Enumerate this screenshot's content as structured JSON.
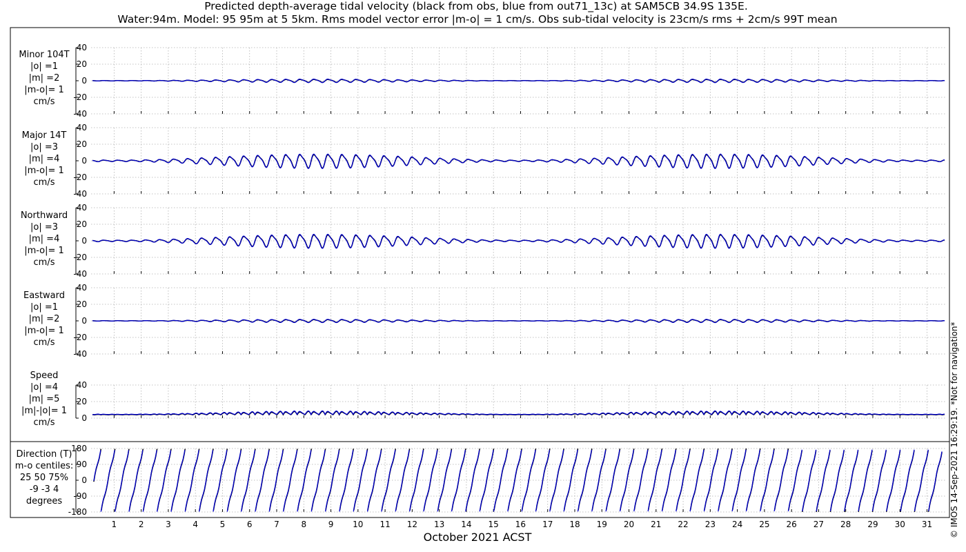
{
  "figure": {
    "title_line1": "Predicted depth-average tidal velocity (black from obs, blue from out71_13c) at SAM5CB 34.9S 135E.",
    "title_line2": "Water:94m. Model: 95 95m at 5 5km. Rms model vector error |m-o| = 1 cm/s. Obs sub-tidal velocity is 23cm/s rms + 2cm/s 99T mean",
    "xlabel": "October 2021 ACST",
    "copyright": "© IMOS 14-Sep-2021 16:29:19. *Not for navigation*",
    "colors": {
      "obs": "#000000",
      "model": "#0000cc",
      "grid": "#b0b0b0"
    }
  },
  "chart_data": [
    {
      "type": "line",
      "name": "minor",
      "label_lines": [
        "Minor 104T",
        "|o| =1",
        "|m| =2",
        "|m-o|= 1",
        "cm/s"
      ],
      "ylim": [
        -40,
        40
      ],
      "yticks": [
        40,
        20,
        0,
        -20,
        -40
      ],
      "xlim": [
        0.15,
        31.7
      ],
      "xticks": [
        1,
        2,
        3,
        4,
        5,
        6,
        7,
        8,
        9,
        10,
        11,
        12,
        13,
        14,
        15,
        16,
        17,
        18,
        19,
        20,
        21,
        22,
        23,
        24,
        25,
        26,
        27,
        28,
        29,
        30,
        31
      ],
      "series": [
        {
          "role": "obs",
          "amplitude": 1.6,
          "offset": 0
        },
        {
          "role": "model",
          "amplitude": 1.9,
          "offset": 0
        }
      ]
    },
    {
      "type": "line",
      "name": "major",
      "label_lines": [
        "Major 14T",
        "|o| =3",
        "|m| =4",
        "|m-o|= 1",
        "cm/s"
      ],
      "ylim": [
        -40,
        40
      ],
      "yticks": [
        40,
        20,
        0,
        -20,
        -40
      ],
      "xlim": [
        0.15,
        31.7
      ],
      "xticks": [
        1,
        2,
        3,
        4,
        5,
        6,
        7,
        8,
        9,
        10,
        11,
        12,
        13,
        14,
        15,
        16,
        17,
        18,
        19,
        20,
        21,
        22,
        23,
        24,
        25,
        26,
        27,
        28,
        29,
        30,
        31
      ],
      "series": [
        {
          "role": "obs",
          "amplitude": 7.5,
          "offset": 0
        },
        {
          "role": "model",
          "amplitude": 8.0,
          "offset": 0
        }
      ]
    },
    {
      "type": "line",
      "name": "northward",
      "label_lines": [
        "Northward",
        "|o| =3",
        "|m| =4",
        "|m-o|= 1",
        "cm/s"
      ],
      "ylim": [
        -40,
        40
      ],
      "yticks": [
        40,
        20,
        0,
        -20,
        -40
      ],
      "xlim": [
        0.15,
        31.7
      ],
      "xticks": [
        1,
        2,
        3,
        4,
        5,
        6,
        7,
        8,
        9,
        10,
        11,
        12,
        13,
        14,
        15,
        16,
        17,
        18,
        19,
        20,
        21,
        22,
        23,
        24,
        25,
        26,
        27,
        28,
        29,
        30,
        31
      ],
      "series": [
        {
          "role": "obs",
          "amplitude": 7.3,
          "offset": 0
        },
        {
          "role": "model",
          "amplitude": 7.8,
          "offset": 0
        }
      ]
    },
    {
      "type": "line",
      "name": "eastward",
      "label_lines": [
        "Eastward",
        "|o| =1",
        "|m| =2",
        "|m-o|= 1",
        "cm/s"
      ],
      "ylim": [
        -40,
        40
      ],
      "yticks": [
        40,
        20,
        0,
        -20,
        -40
      ],
      "xlim": [
        0.15,
        31.7
      ],
      "xticks": [
        1,
        2,
        3,
        4,
        5,
        6,
        7,
        8,
        9,
        10,
        11,
        12,
        13,
        14,
        15,
        16,
        17,
        18,
        19,
        20,
        21,
        22,
        23,
        24,
        25,
        26,
        27,
        28,
        29,
        30,
        31
      ],
      "series": [
        {
          "role": "obs",
          "amplitude": 1.5,
          "offset": 0
        },
        {
          "role": "model",
          "amplitude": 1.8,
          "offset": 0
        }
      ]
    },
    {
      "type": "line",
      "name": "speed",
      "label_lines": [
        "Speed",
        "|o| =4",
        "|m| =5",
        "|m|-|o|= 1",
        "cm/s"
      ],
      "ylim": [
        0,
        40
      ],
      "yticks": [
        40,
        20,
        0
      ],
      "xlim": [
        0.15,
        31.7
      ],
      "xticks": [
        1,
        2,
        3,
        4,
        5,
        6,
        7,
        8,
        9,
        10,
        11,
        12,
        13,
        14,
        15,
        16,
        17,
        18,
        19,
        20,
        21,
        22,
        23,
        24,
        25,
        26,
        27,
        28,
        29,
        30,
        31
      ],
      "series": [
        {
          "role": "obs",
          "amplitude": 3.5,
          "offset": 4
        },
        {
          "role": "model",
          "amplitude": 3.8,
          "offset": 4.3
        }
      ]
    },
    {
      "type": "line",
      "name": "direction",
      "label_lines": [
        "Direction (T)",
        "m-o centiles:",
        "25  50  75%",
        "-9 -3  4",
        "degrees"
      ],
      "ylim": [
        -180,
        180
      ],
      "yticks": [
        180,
        90,
        0,
        -90,
        -180
      ],
      "ytick_labels": [
        "180",
        "90",
        "0",
        "-90",
        "-180"
      ],
      "xlim": [
        0.15,
        31.7
      ],
      "xticks": [
        1,
        2,
        3,
        4,
        5,
        6,
        7,
        8,
        9,
        10,
        11,
        12,
        13,
        14,
        15,
        16,
        17,
        18,
        19,
        20,
        21,
        22,
        23,
        24,
        25,
        26,
        27,
        28,
        29,
        30,
        31
      ],
      "series": [
        {
          "role": "obs",
          "wrap_degrees": 180
        },
        {
          "role": "model",
          "wrap_degrees": 180
        }
      ]
    }
  ]
}
